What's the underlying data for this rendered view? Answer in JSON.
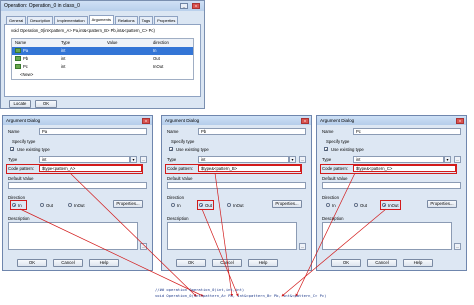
{
  "operation_window": {
    "title": "Operation: Operation_0 in class_0",
    "tabs": [
      "General",
      "Description",
      "Implementation",
      "Arguments",
      "Relations",
      "Tags",
      "Properties"
    ],
    "active_tab": "Arguments",
    "signature": "void Operation_0(int<pattern_A> Pa,int&<pattern_B> Pb,int&<pattern_C> Pc)",
    "grid": {
      "headers": [
        "Name",
        "Type",
        "Value",
        "direction"
      ],
      "rows": [
        {
          "name": "Pa",
          "type": "int",
          "value": "",
          "direction": "In"
        },
        {
          "name": "Pb",
          "type": "int",
          "value": "",
          "direction": "Out"
        },
        {
          "name": "Pc",
          "type": "int",
          "value": "",
          "direction": "InOut"
        }
      ],
      "new_row": "<New>"
    },
    "locate_label": "Locate",
    "ok_label": "OK"
  },
  "dialog_common": {
    "title": "Argument Dialog",
    "name_label": "Name",
    "specify_type_label": "Specify type",
    "use_existing_label": "Use existing type",
    "type_label": "Type",
    "type_value": "int",
    "code_pattern_label": "Code pattern:",
    "default_value_label": "Default Value",
    "direction_label": "Direction",
    "dir_in": "In",
    "dir_out": "Out",
    "dir_inout": "InOut",
    "properties_label": "Properties...",
    "description_label": "Description",
    "ok_label": "OK",
    "cancel_label": "Cancel",
    "help_label": "Help",
    "ellipsis": "..."
  },
  "dialogs": [
    {
      "name": "Pa",
      "code_pattern": "$type<pattern_A>",
      "direction": "In"
    },
    {
      "name": "Pb",
      "code_pattern": "$type&<pattern_B>",
      "direction": "Out"
    },
    {
      "name": "Pc",
      "code_pattern": "$type&<pattern_C>",
      "direction": "InOut"
    }
  ],
  "generated_code": {
    "line1": "//## operation Operation_0(int,int,int)",
    "line2": "void Operation_0(int<pattern_A> Pa, int&<pattern_B> Pb, int&<pattern_C> Pc)"
  }
}
